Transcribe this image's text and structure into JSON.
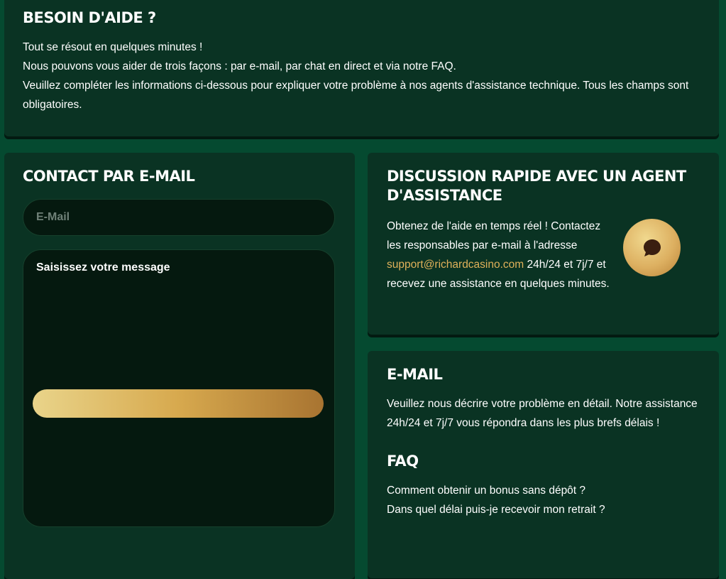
{
  "help": {
    "title": "BESOIN D'AIDE ?",
    "lines": [
      "Tout se résout en quelques minutes !",
      "Nous pouvons vous aider de trois façons : par e-mail, par chat en direct et via notre FAQ.",
      "Veuillez compléter les informations ci-dessous pour expliquer votre problème à nos agents d'assistance technique. Tous les champs sont obligatoires."
    ]
  },
  "contact": {
    "title": "CONTACT PAR E-MAIL",
    "email_placeholder": "E-Mail",
    "email_value": "",
    "message_placeholder": "Saisissez votre message",
    "message_value": ""
  },
  "chat": {
    "title": "DISCUSSION RAPIDE AVEC UN AGENT D'ASSISTANCE",
    "text_before": "Obtenez de l'aide en temps réel ! Contactez les responsables par e-mail à l'adresse ",
    "email_link": "support@richardcasino.com",
    "text_after": " 24h/24 et 7j/7 et recevez une assistance en quelques minutes.",
    "icon": "chat-bubble-icon",
    "accent_color": "#e0b15a"
  },
  "email_info": {
    "title": "E-MAIL",
    "text": "Veuillez nous décrire votre problème en détail. Notre assistance 24h/24 et 7j/7 vous répondra dans les plus brefs délais !"
  },
  "faq": {
    "title": "FAQ",
    "items": [
      "Comment obtenir un bonus sans dépôt ?",
      "Dans quel délai puis-je recevoir mon retrait ?"
    ]
  },
  "colors": {
    "page_background": "#054a30",
    "panel_background": "#0a3323",
    "input_background": "#05190f",
    "gold": "#d7a94e"
  }
}
